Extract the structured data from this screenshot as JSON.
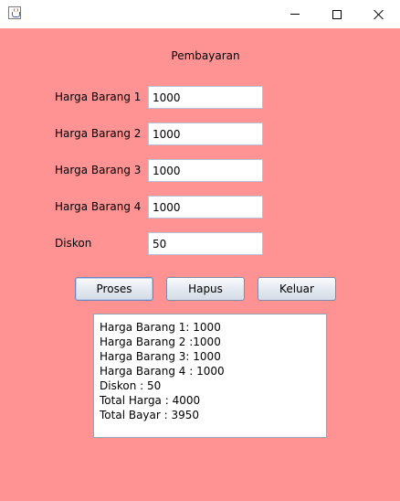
{
  "window": {
    "title": "",
    "background_color": "#ff9393"
  },
  "titlebar": {
    "app_icon": "java-cup-icon",
    "minimize_icon": "minimize-icon",
    "maximize_icon": "maximize-icon",
    "close_icon": "close-icon"
  },
  "form": {
    "heading": "Pembayaran",
    "fields": [
      {
        "label": "Harga Barang 1",
        "value": "1000"
      },
      {
        "label": "Harga Barang 2",
        "value": "1000"
      },
      {
        "label": "Harga Barang 3",
        "value": "1000"
      },
      {
        "label": "Harga Barang 4",
        "value": "1000"
      },
      {
        "label": "Diskon",
        "value": "50"
      }
    ]
  },
  "buttons": {
    "proses": "Proses",
    "hapus": "Hapus",
    "keluar": "Keluar"
  },
  "output": {
    "lines": [
      "Harga Barang 1: 1000",
      "Harga Barang 2 :1000",
      "Harga Barang 3: 1000",
      "Harga Barang 4 : 1000",
      "Diskon : 50",
      "Total Harga : 4000",
      "Total Bayar : 3950"
    ]
  }
}
